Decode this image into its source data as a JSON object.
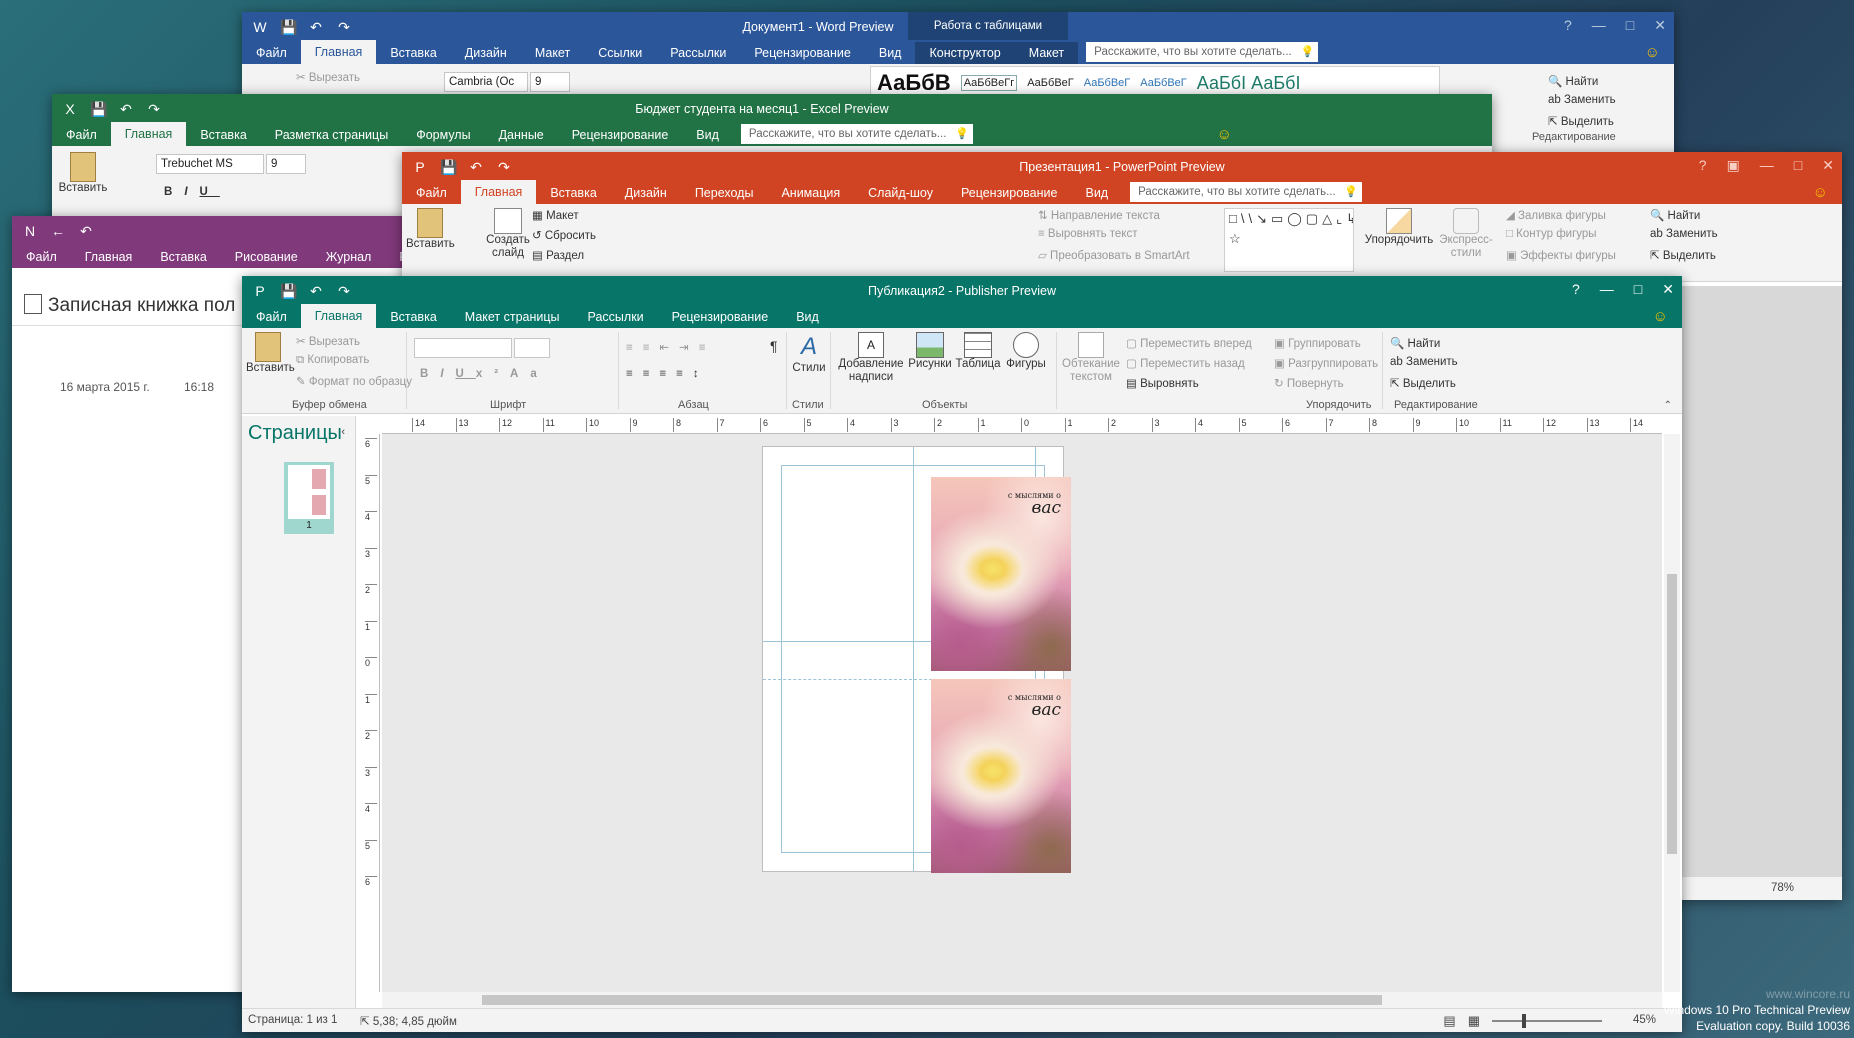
{
  "word": {
    "title": "Документ1 - Word Preview",
    "context_tab_group": "Работа с таблицами",
    "tabs": [
      "Файл",
      "Главная",
      "Вставка",
      "Дизайн",
      "Макет",
      "Ссылки",
      "Рассылки",
      "Рецензирование",
      "Вид",
      "Конструктор",
      "Макет"
    ],
    "tell_me": "Расскажите, что вы хотите сделать...",
    "cut": "Вырезать",
    "font": "Cambria (Ос",
    "size": "9",
    "styles_sample_big": "АаБбВ",
    "styles_samples": [
      "АаБбВеГг",
      "АаБбВеГ",
      "АаБбВеГ",
      "АаБбВеГ",
      "АаБбВ"
    ],
    "styles_sample_heading": "АаБбІ АаБбІ",
    "find": "Найти",
    "replace": "Заменить",
    "select": "Выделить",
    "editing_group": "Редактирование"
  },
  "excel": {
    "title": "Бюджет студента на месяц1 - Excel Preview",
    "tabs": [
      "Файл",
      "Главная",
      "Вставка",
      "Разметка страницы",
      "Формулы",
      "Данные",
      "Рецензирование",
      "Вид"
    ],
    "tell_me": "Расскажите, что вы хотите сделать...",
    "paste": "Вставить",
    "font": "Trebuchet MS",
    "size": "9"
  },
  "powerpoint": {
    "title": "Презентация1 - PowerPoint Preview",
    "tabs": [
      "Файл",
      "Главная",
      "Вставка",
      "Дизайн",
      "Переходы",
      "Анимация",
      "Слайд-шоу",
      "Рецензирование",
      "Вид"
    ],
    "tell_me": "Расскажите, что вы хотите сделать...",
    "paste": "Вставить",
    "new_slide": "Создать слайд",
    "layout": "Макет",
    "reset": "Сбросить",
    "section": "Раздел",
    "text_direction": "Направление текста",
    "align_text": "Выровнять текст",
    "smartart": "Преобразовать в SmartArt",
    "arrange": "Упорядочить",
    "quick_styles": "Экспресс-стили",
    "shape_fill": "Заливка фигуры",
    "shape_outline": "Контур фигуры",
    "shape_effects": "Эффекты фигуры",
    "find": "Найти",
    "replace": "Заменить",
    "select": "Выделить",
    "editing_group": "Редактирование",
    "zoom": "78%"
  },
  "onenote": {
    "tabs": [
      "Файл",
      "Главная",
      "Вставка",
      "Рисование",
      "Журнал",
      "Р"
    ],
    "notebook": "Записная книжка пол",
    "date": "16 марта 2015 г.",
    "time": "16:18"
  },
  "publisher": {
    "title": "Публикация2 - Publisher Preview",
    "tabs": [
      "Файл",
      "Главная",
      "Вставка",
      "Макет страницы",
      "Рассылки",
      "Рецензирование",
      "Вид"
    ],
    "clipboard": {
      "paste": "Вставить",
      "cut": "Вырезать",
      "copy": "Копировать",
      "format_painter": "Формат по образцу",
      "label": "Буфер обмена"
    },
    "font_label": "Шрифт",
    "paragraph_label": "Абзац",
    "styles": {
      "button": "Стили",
      "label": "Стили"
    },
    "objects": {
      "text_box": "Добавление надписи",
      "pictures": "Рисунки",
      "table": "Таблица",
      "shapes": "Фигуры",
      "label": "Объекты"
    },
    "wrap_text": "Обтекание текстом",
    "arrange": {
      "bring_forward": "Переместить вперед",
      "send_backward": "Переместить назад",
      "align": "Выровнять",
      "group": "Группировать",
      "ungroup": "Разгруппировать",
      "rotate": "Повернуть",
      "label": "Упорядочить"
    },
    "editing": {
      "find": "Найти",
      "replace": "Заменить",
      "select": "Выделить",
      "label": "Редактирование"
    },
    "pages_title": "Страницы",
    "page_number": "1",
    "ruler_h": [
      "14",
      "13",
      "12",
      "11",
      "10",
      "9",
      "8",
      "7",
      "6",
      "5",
      "4",
      "3",
      "2",
      "1",
      "0",
      "1",
      "2",
      "3",
      "4",
      "5",
      "6",
      "7",
      "8",
      "9",
      "10",
      "11",
      "12",
      "13",
      "14"
    ],
    "ruler_v": [
      "6",
      "5",
      "4",
      "3",
      "2",
      "1",
      "0",
      "1",
      "2",
      "3",
      "4",
      "5",
      "6"
    ],
    "card_small_text": "с мыслями о",
    "card_big_text": "вас",
    "status_page": "Страница: 1 из 1",
    "status_position": "5,38; 4,85 дюйм",
    "zoom": "45%"
  },
  "desktop": {
    "watermark_line1": "Windows 10 Pro Technical Preview",
    "watermark_line2": "Evaluation copy. Build 10036",
    "site": "www.wincore.ru"
  },
  "colors": {
    "word": "#2b579a",
    "excel": "#217346",
    "powerpoint": "#d04423",
    "onenote": "#80397b",
    "publisher": "#077568"
  }
}
